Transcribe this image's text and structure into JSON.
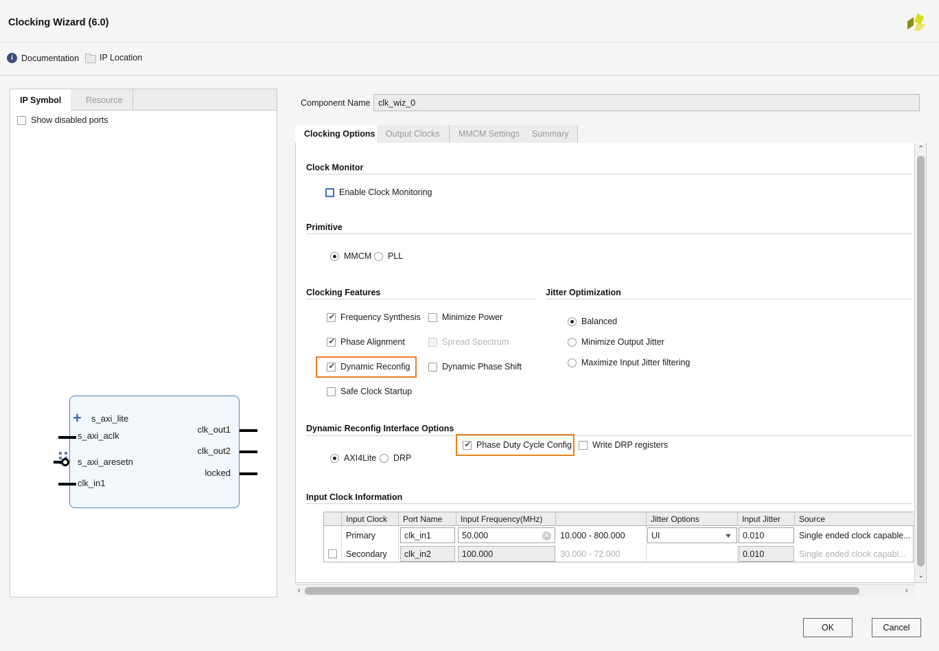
{
  "window": {
    "title": "Clocking Wizard (6.0)",
    "logo_icon": "amd-xilinx-logo-icon",
    "logo_colors": [
      "#d6df36",
      "#8a8f12",
      "#e3e86b"
    ]
  },
  "linkbar": {
    "documentation": {
      "label": "Documentation",
      "icon": "info-icon"
    },
    "ip_location": {
      "label": "IP Location",
      "icon": "folder-icon"
    }
  },
  "left_panel": {
    "tabs": [
      {
        "label": "IP Symbol",
        "active": true
      },
      {
        "label": "Resource",
        "active": false
      }
    ],
    "show_disabled_ports": {
      "label": "Show disabled ports",
      "checked": false
    },
    "symbol": {
      "left_ports": [
        {
          "name": "s_axi_lite",
          "type": "bus",
          "icon": "plus-expand-icon"
        },
        {
          "name": "s_axi_aclk",
          "type": "pin"
        },
        {
          "name": "s_axi_aresetn",
          "type": "pin-active-low"
        },
        {
          "name": "clk_in1",
          "type": "pin"
        }
      ],
      "right_ports": [
        {
          "name": "clk_out1",
          "type": "pin"
        },
        {
          "name": "clk_out2",
          "type": "pin"
        },
        {
          "name": "locked",
          "type": "pin"
        }
      ]
    }
  },
  "component": {
    "label": "Component Name",
    "value": "clk_wiz_0"
  },
  "tabs": [
    {
      "label": "Clocking Options",
      "active": true
    },
    {
      "label": "Output Clocks",
      "active": false
    },
    {
      "label": "MMCM Settings",
      "active": false
    },
    {
      "label": "Summary",
      "active": false
    }
  ],
  "clock_monitor": {
    "title": "Clock Monitor",
    "enable": {
      "label": "Enable Clock Monitoring",
      "checked": false,
      "focused": true
    }
  },
  "primitive": {
    "title": "Primitive",
    "options": [
      {
        "label": "MMCM",
        "selected": true
      },
      {
        "label": "PLL",
        "selected": false
      }
    ]
  },
  "clocking_features": {
    "title": "Clocking Features",
    "items": [
      {
        "label": "Frequency Synthesis",
        "checked": true,
        "disabled": false,
        "highlighted": false
      },
      {
        "label": "Minimize Power",
        "checked": false,
        "disabled": false,
        "highlighted": false
      },
      {
        "label": "Phase Alignment",
        "checked": true,
        "disabled": false,
        "highlighted": false
      },
      {
        "label": "Spread Spectrum",
        "checked": false,
        "disabled": true,
        "highlighted": false
      },
      {
        "label": "Dynamic Reconfig",
        "checked": true,
        "disabled": false,
        "highlighted": true
      },
      {
        "label": "Dynamic Phase Shift",
        "checked": false,
        "disabled": false,
        "highlighted": false
      },
      {
        "label": "Safe Clock Startup",
        "checked": false,
        "disabled": false,
        "highlighted": false
      }
    ]
  },
  "jitter_optimization": {
    "title": "Jitter Optimization",
    "options": [
      {
        "label": "Balanced",
        "selected": true
      },
      {
        "label": "Minimize Output Jitter",
        "selected": false
      },
      {
        "label": "Maximize Input Jitter filtering",
        "selected": false
      }
    ]
  },
  "dynamic_reconfig": {
    "title": "Dynamic Reconfig Interface Options",
    "interface": [
      {
        "label": "AXI4Lite",
        "selected": true
      },
      {
        "label": "DRP",
        "selected": false
      }
    ],
    "phase_duty_cycle_config": {
      "label": "Phase Duty Cycle Config",
      "checked": true,
      "highlighted": true
    },
    "write_drp_registers": {
      "label": "Write DRP registers",
      "checked": false,
      "highlighted": false
    }
  },
  "input_clock_information": {
    "title": "Input Clock Information",
    "columns": [
      "",
      "Input Clock",
      "Port Name",
      "Input Frequency(MHz)",
      "",
      "Jitter Options",
      "Input Jitter",
      "Source"
    ],
    "rows": [
      {
        "checkbox": null,
        "input_clock": "Primary",
        "port_name": "clk_in1",
        "input_frequency": "50.000",
        "frequency_clear_icon": "clear-circle-icon",
        "range": "10.000 - 800.000",
        "jitter_options": "UI",
        "input_jitter": "0.010",
        "source": "Single ended clock capable...",
        "enabled": true
      },
      {
        "checkbox": false,
        "input_clock": "Secondary",
        "port_name": "clk_in2",
        "input_frequency": "100.000",
        "frequency_clear_icon": null,
        "range": "30.000 - 72.000",
        "jitter_options": "",
        "input_jitter": "0.010",
        "source": "Single ended clock capabl...",
        "enabled": false
      }
    ]
  },
  "scrollbars": {
    "vertical": {
      "up_icon": "chevron-up-icon",
      "down_icon": "chevron-down-icon"
    },
    "horizontal": {
      "left_icon": "chevron-left-icon",
      "right_icon": "chevron-right-icon"
    }
  },
  "footer": {
    "ok": "OK",
    "cancel": "Cancel"
  },
  "colors": {
    "highlight": "#e8821e",
    "focus": "#3b6fc4",
    "symbol_border": "#5a7fae"
  }
}
